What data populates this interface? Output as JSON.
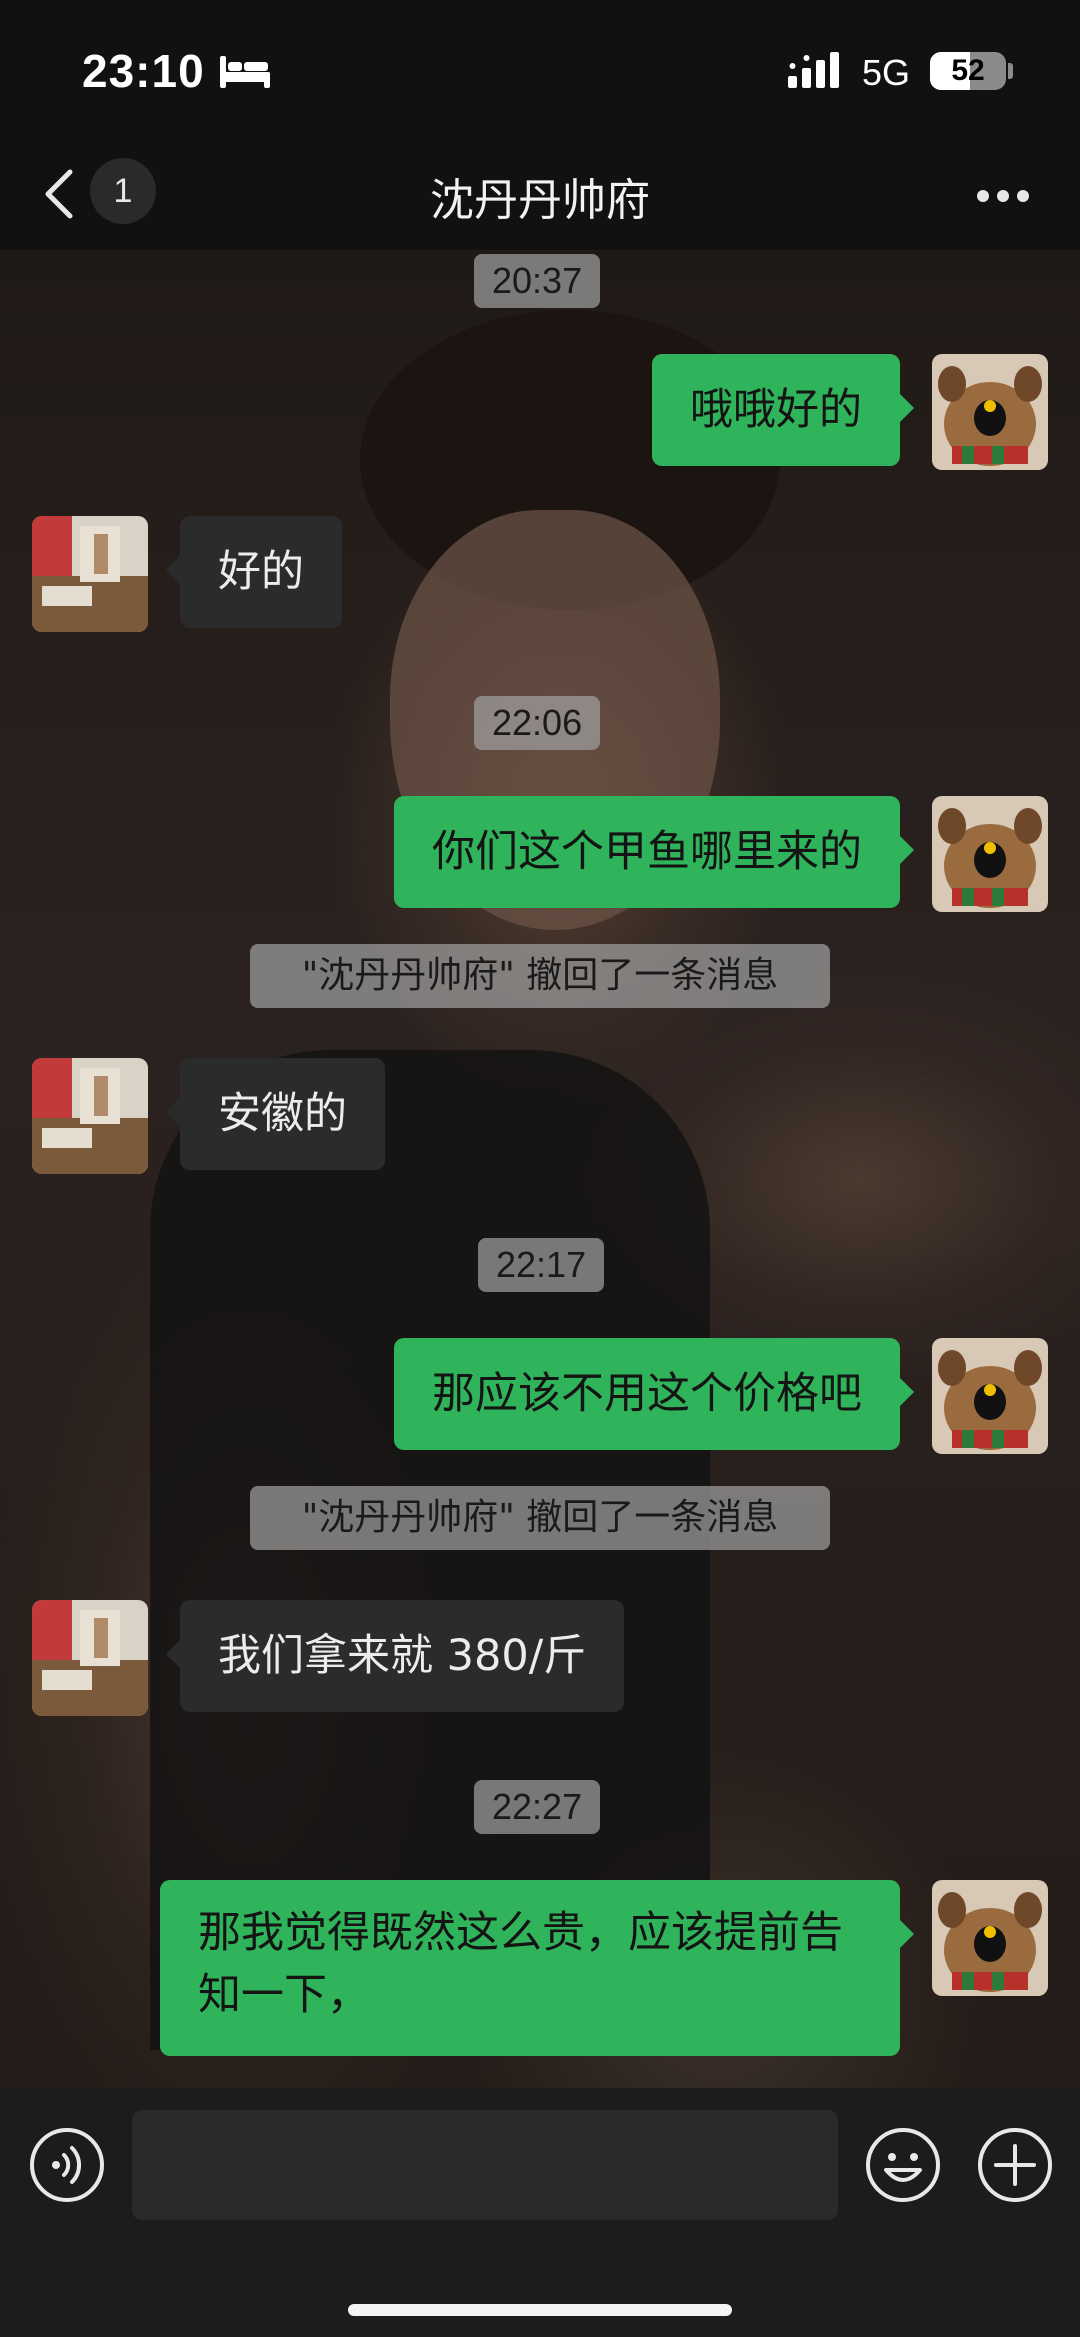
{
  "status_bar": {
    "time": "23:10",
    "network": "5G",
    "battery": "52",
    "battery_level": 0.52
  },
  "header": {
    "unread_count": "1",
    "title": "沈丹丹帅府"
  },
  "messages": [
    {
      "type": "timestamp",
      "text": "20:37"
    },
    {
      "type": "message",
      "from": "self",
      "text": "哦哦好的"
    },
    {
      "type": "message",
      "from": "other",
      "text": "好的"
    },
    {
      "type": "timestamp",
      "text": "22:06"
    },
    {
      "type": "message",
      "from": "self",
      "text": "你们这个甲鱼哪里来的"
    },
    {
      "type": "system",
      "text": "\"沈丹丹帅府\" 撤回了一条消息"
    },
    {
      "type": "message",
      "from": "other",
      "text": "安徽的"
    },
    {
      "type": "timestamp",
      "text": "22:17"
    },
    {
      "type": "message",
      "from": "self",
      "text": "那应该不用这个价格吧"
    },
    {
      "type": "system",
      "text": "\"沈丹丹帅府\" 撤回了一条消息"
    },
    {
      "type": "message",
      "from": "other",
      "text": "我们拿来就 380/斤"
    },
    {
      "type": "timestamp",
      "text": "22:27"
    },
    {
      "type": "message",
      "from": "self",
      "text": "那我觉得既然这么贵，应该提前告知一下，"
    }
  ],
  "input": {
    "value": "",
    "placeholder": ""
  },
  "icons": {
    "back": "chevron-left-icon",
    "more": "ellipsis-icon",
    "voice": "voice-icon",
    "emoji": "smiley-icon",
    "plus": "plus-icon"
  },
  "colors": {
    "self_bubble": "#2fb45c",
    "other_bubble": "#2b2b2b",
    "timestamp_bg": "#a0a0a0"
  }
}
